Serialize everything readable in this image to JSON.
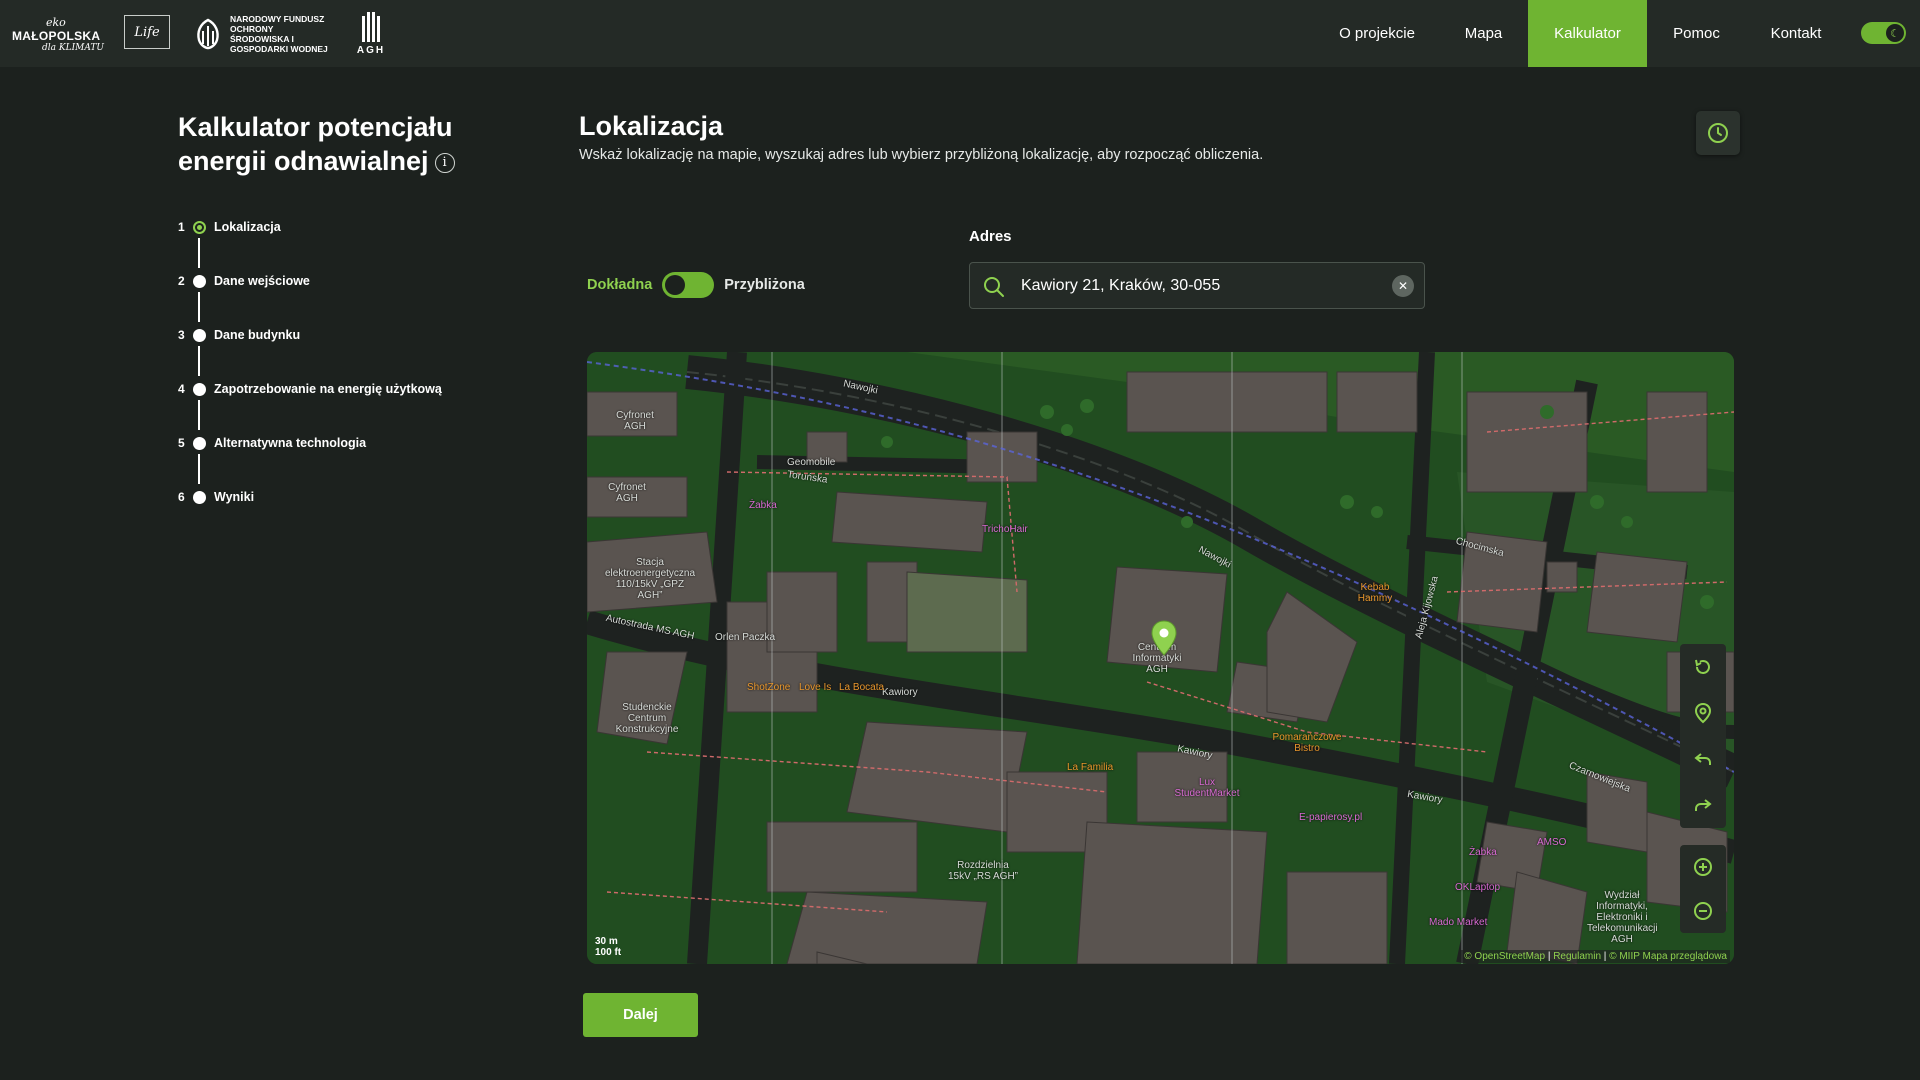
{
  "logos": {
    "malopolska_line1": "eko",
    "malopolska_line2": "MAŁOPOLSKA",
    "malopolska_line3": "dla KLIMATU",
    "life": "Life",
    "nfos": "NARODOWY FUNDUSZ OCHRONY ŚRODOWISKA I GOSPODARKI WODNEJ",
    "agh": "AGH"
  },
  "nav": {
    "items": [
      "O projekcie",
      "Mapa",
      "Kalkulator",
      "Pomoc",
      "Kontakt"
    ],
    "active": "Kalkulator",
    "theme_icon": "moon-icon"
  },
  "sidebar": {
    "title": "Kalkulator potencjału energii odnawialnej",
    "info_icon": "i",
    "steps": [
      {
        "num": "1",
        "label": "Lokalizacja",
        "active": true
      },
      {
        "num": "2",
        "label": "Dane wejściowe"
      },
      {
        "num": "3",
        "label": "Dane budynku"
      },
      {
        "num": "4",
        "label": "Zapotrzebowanie na energię użytkową"
      },
      {
        "num": "5",
        "label": "Alternatywna technologia"
      },
      {
        "num": "6",
        "label": "Wyniki"
      }
    ]
  },
  "main": {
    "title": "Lokalizacja",
    "subtitle": "Wskaż lokalizację na mapie, wyszukaj adres lub wybierz przybliżoną lokalizację, aby rozpocząć obliczenia.",
    "mode_left": "Dokładna",
    "mode_right": "Przybliżona",
    "address_label": "Adres",
    "address_value": "Kawiory 21, Kraków, 30-055",
    "next_button": "Dalej"
  },
  "map": {
    "labels": {
      "nawojki": "Nawojki",
      "torunska": "Toruńska",
      "kawiory": "Kawiory",
      "chocimska": "Chocimska",
      "aleja": "Aleja Kijowska",
      "czarnowiejska": "Czarnowiejska",
      "cyfronet1": "Cyfronet AGH",
      "cyfronet2": "Cyfronet AGH",
      "stacja": "Stacja elektroenergetyczna 110/15kV „GPZ AGH”",
      "autostrada": "Autostrada MS AGH",
      "studenckie": "Studenckie Centrum Konstrukcyjne",
      "centrum": "Centrum Informatyki AGH",
      "geomobile": "Geomobile",
      "zabka1": "Żabka",
      "zabka2": "Żabka",
      "trichohair": "TrichoHair",
      "orlen": "Orlen Paczka",
      "shotzone": "ShotZone",
      "lovels": "Love Is",
      "labocata": "La Bocata",
      "lafamilia": "La Familia",
      "lux": "Lux StudentMarket",
      "epapierosy": "E-papierosy.pl",
      "pomaranczowe": "Pomarańczowe Bistro",
      "kebab": "Kebab Hammy",
      "amso": "AMSO",
      "oklaptop": "OKLaptop",
      "madomarket": "Mado Market",
      "rozdzielnia": "Rozdzielnia 15kV „RS AGH”",
      "wydzial": "Wydział Informatyki, Elektroniki i Telekomunikacji AGH"
    },
    "scale_m": "30 m",
    "scale_ft": "100 ft",
    "attribution_1": "© OpenStreetMap",
    "attribution_2": "Regulamin",
    "attribution_3": "© MIIP Mapa przeglądowa",
    "attribution_sep": "|",
    "controls": [
      "reset-icon",
      "locate-icon",
      "undo-icon",
      "redo-icon",
      "zoom-in-icon",
      "zoom-out-icon"
    ]
  },
  "colors": {
    "accent": "#6fb432",
    "accent_light": "#8fd14f",
    "background": "#1c211e",
    "header": "#242a26",
    "map_green": "#214d20",
    "building": "#5a5450",
    "road": "#1e2220"
  }
}
